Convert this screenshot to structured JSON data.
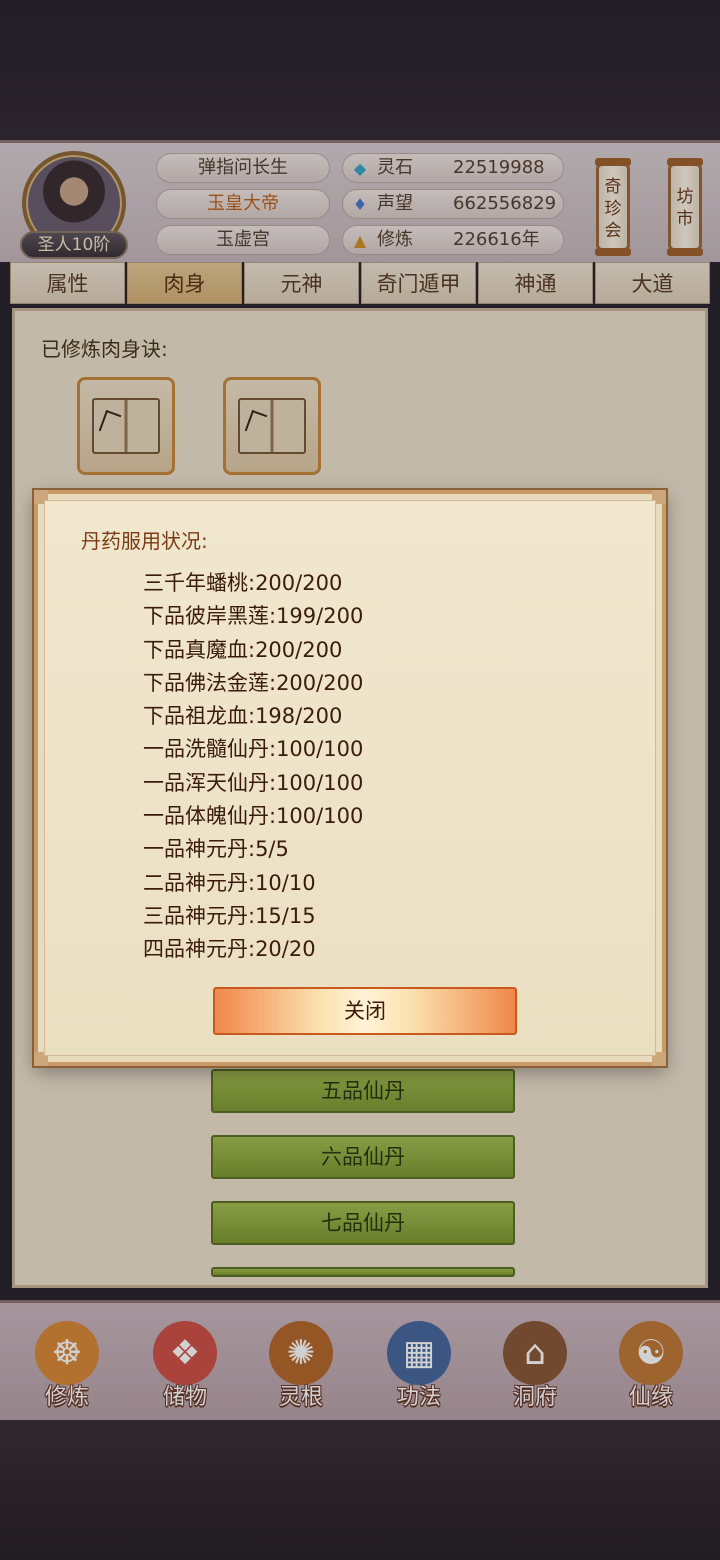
{
  "header": {
    "rank": "圣人10阶",
    "names": [
      "弹指问长生",
      "玉皇大帝",
      "玉虚宫"
    ],
    "stats": [
      {
        "icon": "spirit-stone-icon",
        "label": "灵石",
        "value": "22519988"
      },
      {
        "icon": "prestige-icon",
        "label": "声望",
        "value": "662556829"
      },
      {
        "icon": "cultivation-icon",
        "label": "修炼",
        "value": "226616年"
      }
    ],
    "side_buttons": [
      "奇珍会",
      "坊市"
    ]
  },
  "tabs": [
    {
      "label": "属性",
      "active": false
    },
    {
      "label": "肉身",
      "active": true
    },
    {
      "label": "元神",
      "active": false
    },
    {
      "label": "奇门遁甲",
      "active": false
    },
    {
      "label": "神通",
      "active": false
    },
    {
      "label": "大道",
      "active": false
    }
  ],
  "content": {
    "learned_label": "已修炼肉身诀:",
    "pill_buttons": [
      "五品仙丹",
      "六品仙丹",
      "七品仙丹"
    ]
  },
  "modal": {
    "title": "丹药服用状况:",
    "items": [
      "三千年蟠桃:200/200",
      "下品彼岸黑莲:199/200",
      "下品真魔血:200/200",
      "下品佛法金莲:200/200",
      "下品祖龙血:198/200",
      "一品洗髓仙丹:100/100",
      "一品浑天仙丹:100/100",
      "一品体魄仙丹:100/100",
      "一品神元丹:5/5",
      "二品神元丹:10/10",
      "三品神元丹:15/15",
      "四品神元丹:20/20"
    ],
    "close_label": "关闭"
  },
  "bottom_nav": [
    {
      "label": "修炼",
      "icon": "meditation-icon",
      "color": "#d98a3a"
    },
    {
      "label": "储物",
      "icon": "storage-bag-icon",
      "color": "#d0524a"
    },
    {
      "label": "灵根",
      "icon": "spirit-root-icon",
      "color": "#b5692e"
    },
    {
      "label": "功法",
      "icon": "scripture-cabinet-icon",
      "color": "#4a6aa0"
    },
    {
      "label": "洞府",
      "icon": "cave-dwelling-icon",
      "color": "#8a5a3a"
    },
    {
      "label": "仙缘",
      "icon": "gourd-icon",
      "color": "#c07a3a"
    }
  ]
}
